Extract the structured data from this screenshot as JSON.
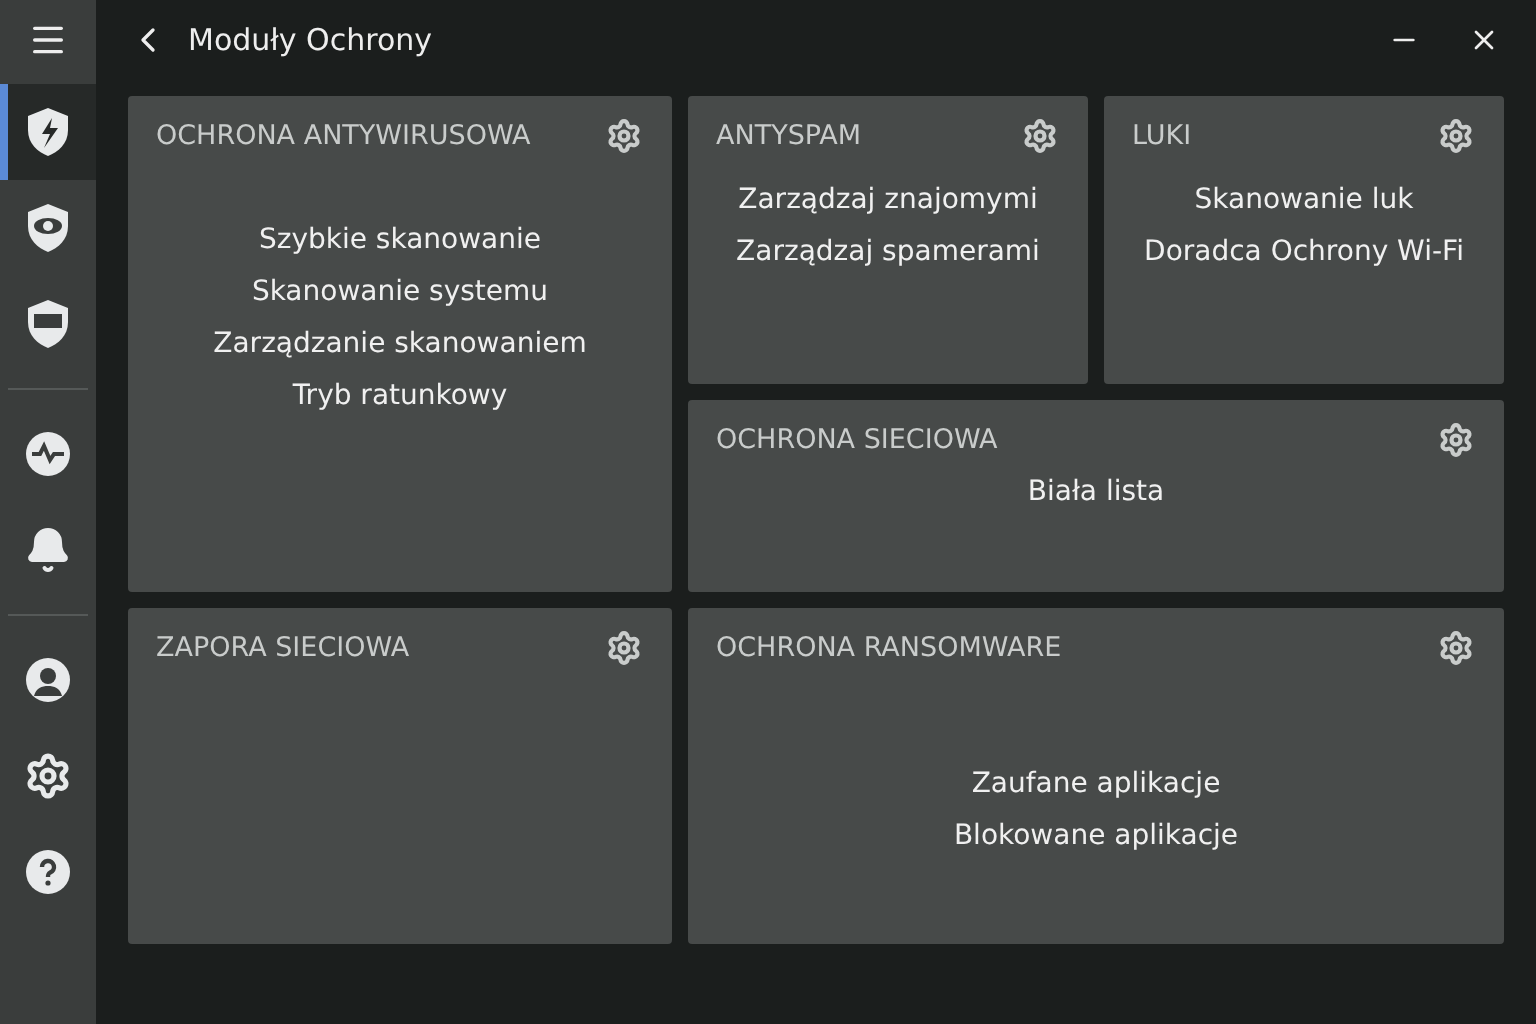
{
  "window": {
    "title": "Moduły Ochrony"
  },
  "sidebar": {
    "items": [
      {
        "selected": true
      },
      {
        "selected": false
      },
      {
        "selected": false
      },
      {
        "selected": false
      },
      {
        "selected": false
      },
      {
        "selected": false
      },
      {
        "selected": false
      },
      {
        "selected": false
      }
    ]
  },
  "cards": [
    {
      "title": "OCHRONA ANTYWIRUSOWA",
      "links": [
        "Szybkie skanowanie",
        "Skanowanie systemu",
        "Zarządzanie skanowaniem",
        "Tryb ratunkowy"
      ]
    },
    {
      "title": "ANTYSPAM",
      "links": [
        "Zarządzaj znajomymi",
        "Zarządzaj spamerami"
      ]
    },
    {
      "title": "LUKI",
      "links": [
        "Skanowanie luk",
        "Doradca Ochrony Wi-Fi"
      ]
    },
    {
      "title": "OCHRONA SIECIOWA",
      "links": [
        "Biała lista"
      ]
    },
    {
      "title": "ZAPORA SIECIOWA"
    },
    {
      "title": "OCHRONA RANSOMWARE",
      "links": [
        "Zaufane aplikacje",
        "Blokowane aplikacje"
      ]
    }
  ]
}
